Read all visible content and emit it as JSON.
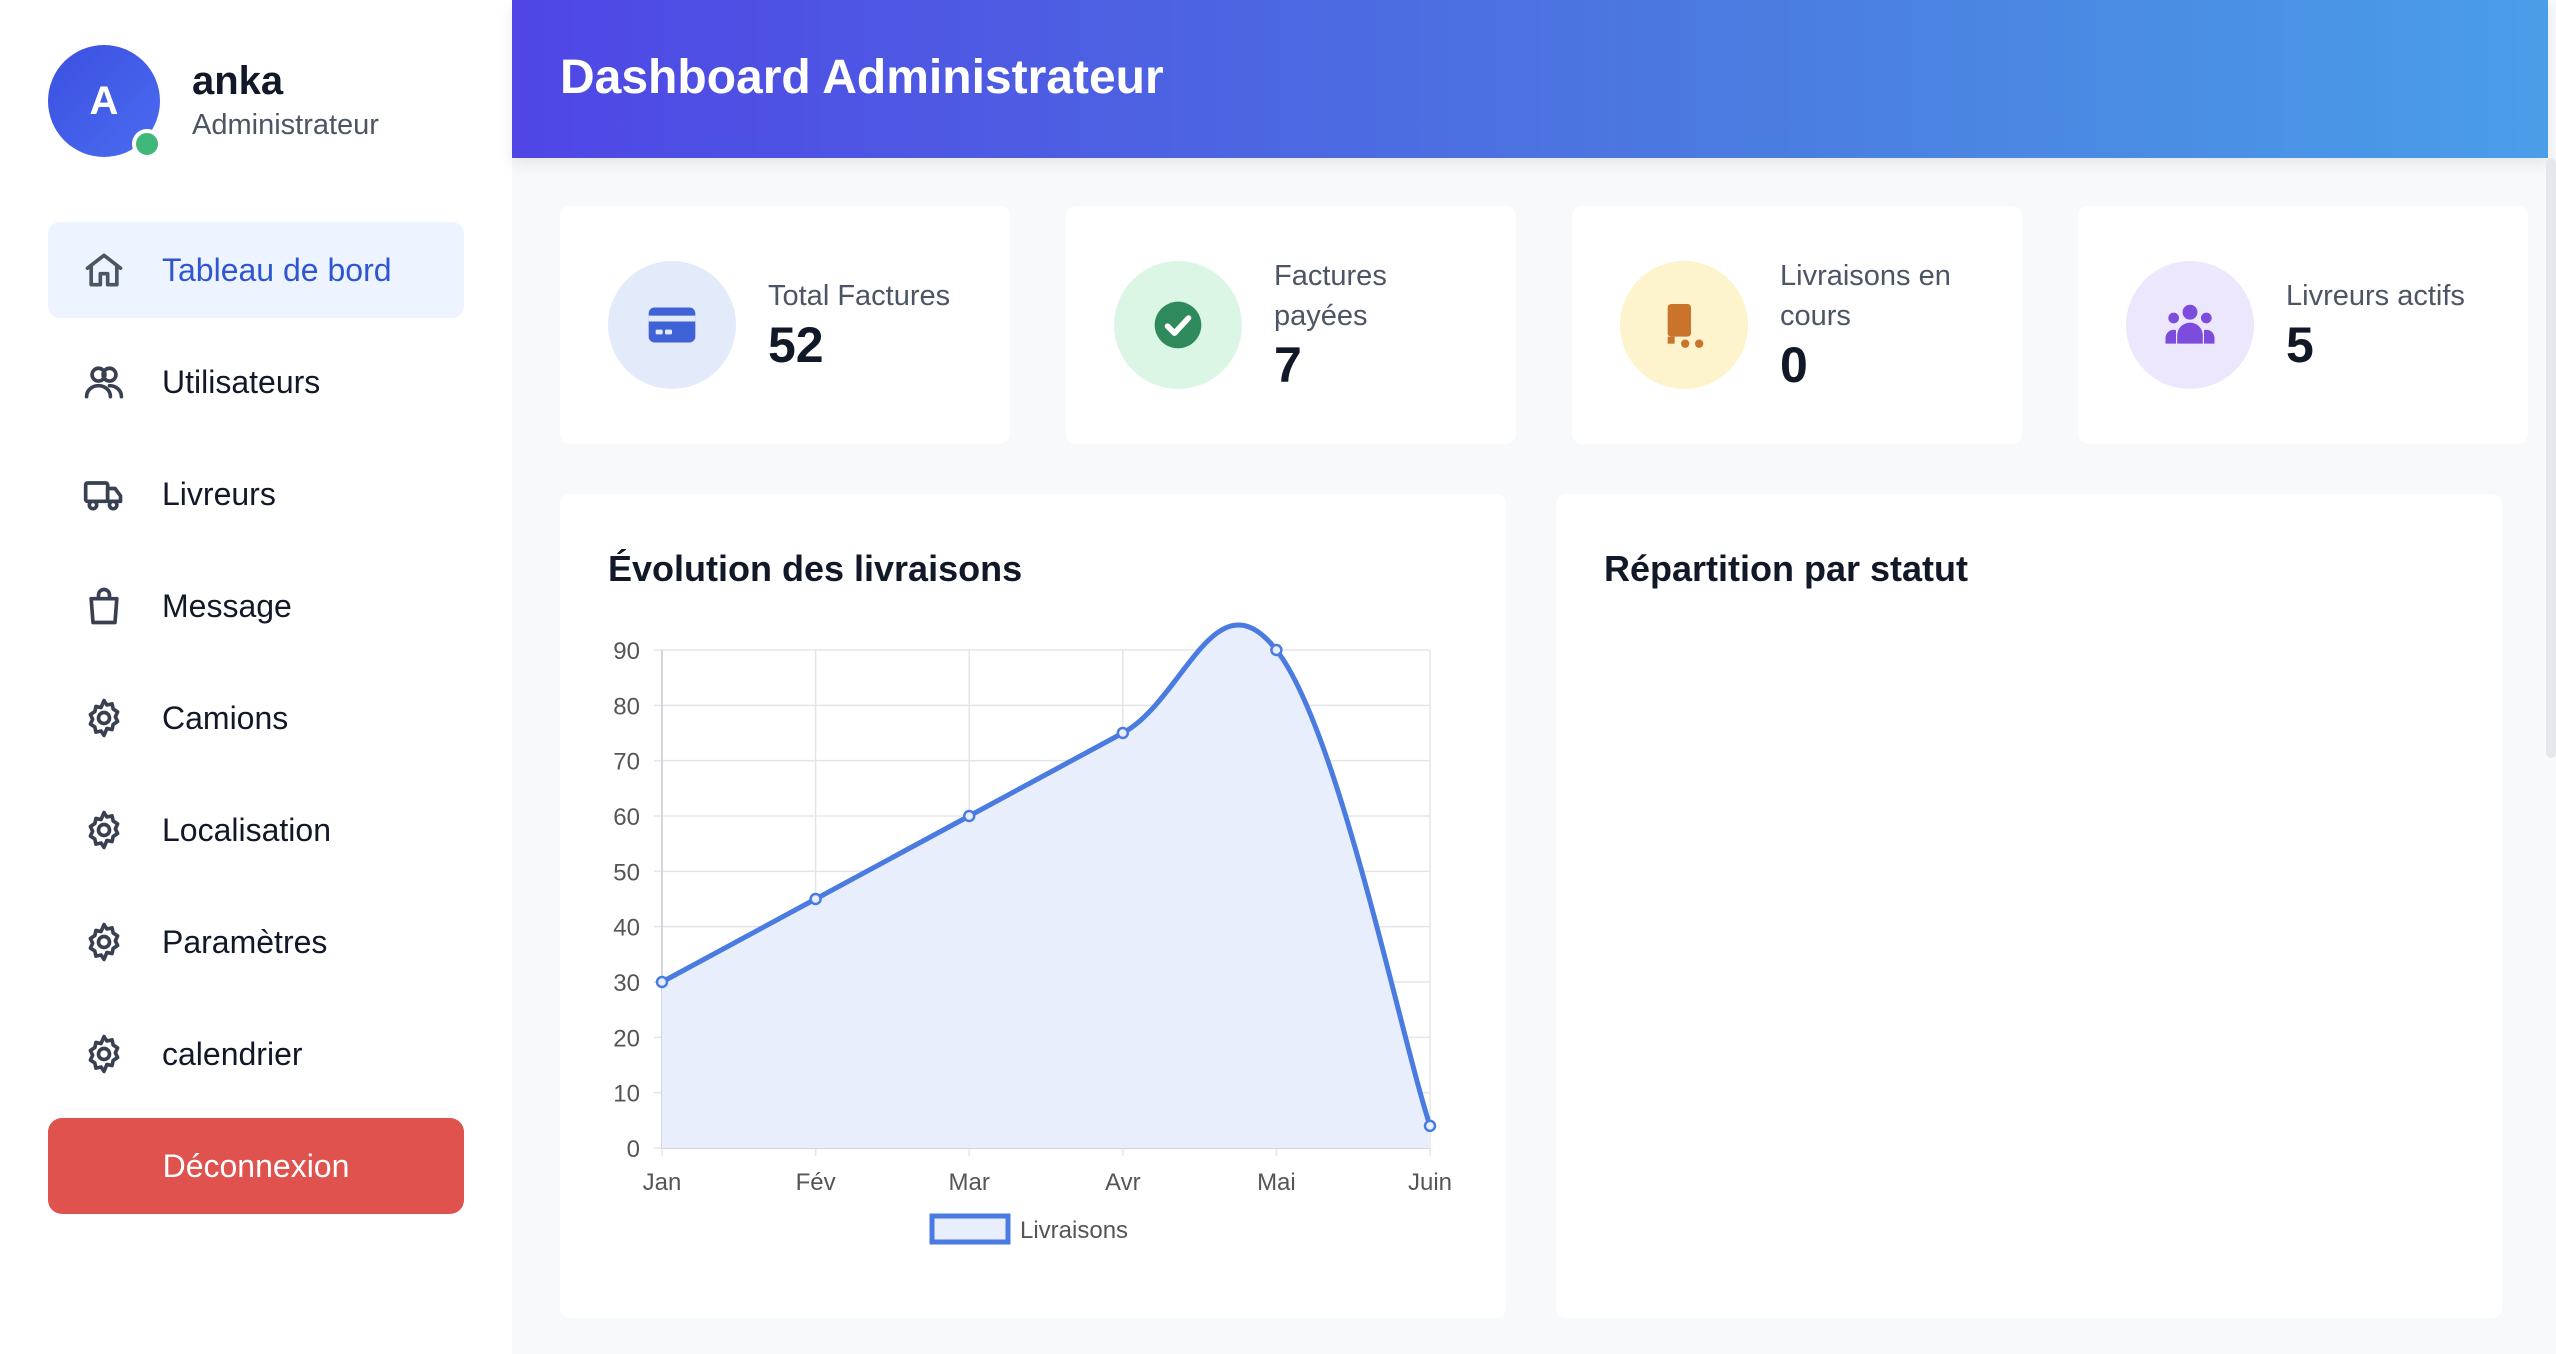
{
  "user": {
    "initial": "A",
    "name": "anka",
    "role": "Administrateur"
  },
  "nav": [
    {
      "label": "Tableau de bord",
      "icon": "home-icon",
      "active": true
    },
    {
      "label": "Utilisateurs",
      "icon": "users-icon"
    },
    {
      "label": "Livreurs",
      "icon": "truck-icon"
    },
    {
      "label": "Message",
      "icon": "shopping-bag-icon"
    },
    {
      "label": "Camions",
      "icon": "gear-icon"
    },
    {
      "label": "Localisation",
      "icon": "gear-icon"
    },
    {
      "label": "Paramètres",
      "icon": "gear-icon"
    },
    {
      "label": "calendrier",
      "icon": "gear-icon"
    }
  ],
  "logout_label": "Déconnexion",
  "header": {
    "title": "Dashboard Administrateur"
  },
  "stats": [
    {
      "label": "Total Factures",
      "value": "52",
      "icon": "credit-card-icon",
      "bg": "#e3ebfb",
      "color": "#3f63d6"
    },
    {
      "label": "Factures payées",
      "value": "7",
      "icon": "check-circle-icon",
      "bg": "#dcf6e6",
      "color": "#2e8a5a"
    },
    {
      "label": "Livraisons en cours",
      "value": "0",
      "icon": "dolly-icon",
      "bg": "#fdf3cc",
      "color": "#c9742a"
    },
    {
      "label": "Livreurs actifs",
      "value": "5",
      "icon": "users-group-icon",
      "bg": "#ede7fd",
      "color": "#7c4ddc"
    }
  ],
  "panels": {
    "evolution_title": "Évolution des livraisons",
    "status_title": "Répartition par statut"
  },
  "chart_data": {
    "type": "line",
    "categories": [
      "Jan",
      "Fév",
      "Mar",
      "Avr",
      "Mai",
      "Juin"
    ],
    "series": [
      {
        "name": "Livraisons",
        "values": [
          30,
          45,
          60,
          75,
          90,
          4
        ]
      }
    ],
    "ylim": [
      0,
      90
    ],
    "yticks": [
      0,
      10,
      20,
      30,
      40,
      50,
      60,
      70,
      80,
      90
    ],
    "grid": true,
    "legend": "bottom",
    "line_color": "#4a7be0",
    "fill_color": "#e8eefb"
  }
}
